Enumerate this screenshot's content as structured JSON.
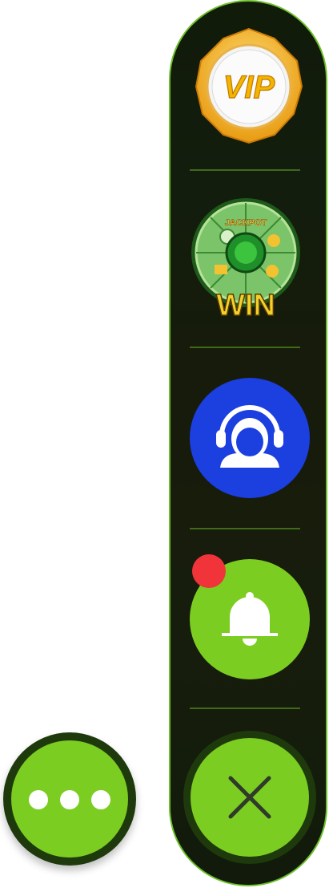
{
  "floating_menu": {
    "vip_button": {
      "label": "VIP",
      "icon": "vip-badge-icon"
    },
    "jackpot_wheel_button": {
      "top_label": "JACKPOT",
      "bottom_label": "WIN",
      "icon": "jackpot-wheel-icon"
    },
    "support_button": {
      "icon": "headset-support-icon",
      "color": "#1c3fe0"
    },
    "notifications_button": {
      "icon": "bell-icon",
      "color": "#7ccd22",
      "has_unread_dot": true,
      "dot_color": "#f0343a"
    },
    "close_button": {
      "icon": "close-x-icon",
      "color": "#7ccd22"
    }
  },
  "more_button": {
    "icon": "more-dots-icon",
    "color": "#7ccd22"
  },
  "colors": {
    "accent_green": "#7ccd22",
    "panel_border": "#6cbf2a",
    "dark_green": "#1e3a0c"
  }
}
